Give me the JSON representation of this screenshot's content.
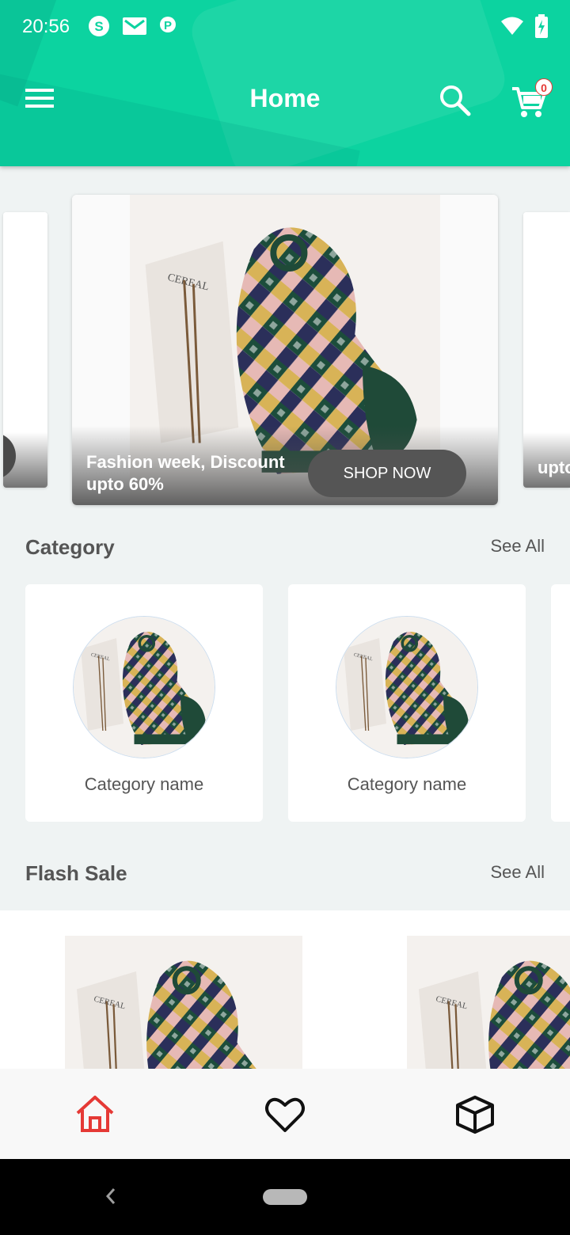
{
  "status_bar": {
    "time": "20:56",
    "icons": [
      "skype-icon",
      "gmail-icon",
      "p-icon"
    ],
    "right_icons": [
      "wifi-icon",
      "battery-charging-icon"
    ]
  },
  "appbar": {
    "title": "Home",
    "menu_icon": "menu-icon",
    "search_icon": "search-icon",
    "cart_icon": "cart-icon",
    "cart_count": "0"
  },
  "carousel": {
    "banner_text": "Fashion week, Discount upto 60%",
    "shop_button": "SHOP NOW",
    "right_peek_text": "upto"
  },
  "category": {
    "title": "Category",
    "see_all": "See All",
    "items": [
      {
        "name": "Category name"
      },
      {
        "name": "Category name"
      }
    ]
  },
  "flash_sale": {
    "title": "Flash Sale",
    "see_all": "See All"
  },
  "bottom_nav": {
    "items": [
      {
        "icon": "home-icon",
        "active": true
      },
      {
        "icon": "heart-icon",
        "active": false
      },
      {
        "icon": "box-icon",
        "active": false
      }
    ],
    "active_color": "#e53935"
  },
  "colors": {
    "accent": "#0cd3a0",
    "badge": "#e53935"
  }
}
